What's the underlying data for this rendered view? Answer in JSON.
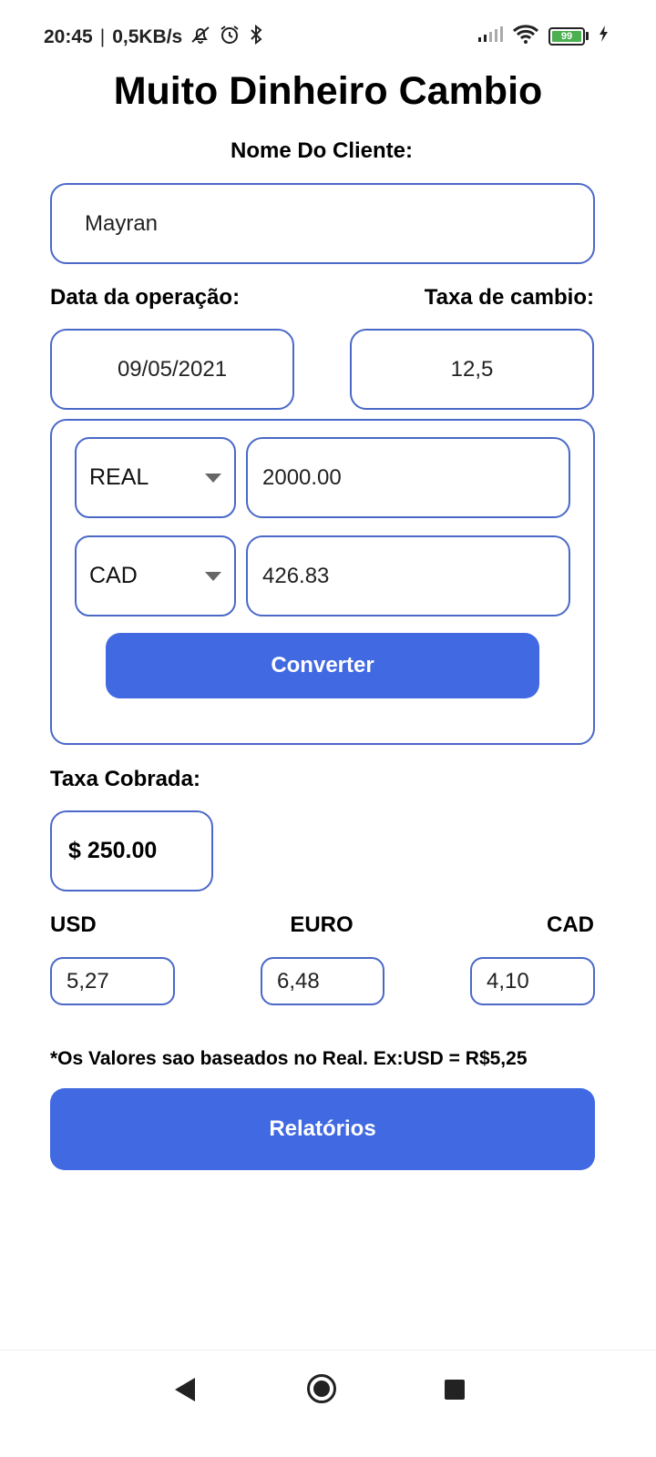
{
  "status_bar": {
    "time": "20:45",
    "separator": "|",
    "network_speed": "0,5KB/s",
    "icons_left": [
      "mute-bell-icon",
      "alarm-icon",
      "bluetooth-icon"
    ],
    "icons_right": [
      "signal-icon",
      "wifi-icon",
      "battery-icon",
      "charging-icon"
    ],
    "battery_level": "99"
  },
  "app": {
    "title": "Muito Dinheiro Cambio"
  },
  "client": {
    "label": "Nome Do Cliente:",
    "value": "Mayran"
  },
  "operation": {
    "date_label": "Data da operação:",
    "date_value": "09/05/2021",
    "rate_label": "Taxa de cambio:",
    "rate_value": "12,5"
  },
  "converter": {
    "from_currency": "REAL",
    "from_amount": "2000.00",
    "to_currency": "CAD",
    "to_amount": "426.83",
    "button_label": "Converter"
  },
  "fee": {
    "label": "Taxa Cobrada:",
    "value": "$ 250.00"
  },
  "rates": {
    "usd_label": "USD",
    "usd_value": "5,27",
    "euro_label": "EURO",
    "euro_value": "6,48",
    "cad_label": "CAD",
    "cad_value": "4,10"
  },
  "note": "*Os Valores sao baseados no Real. Ex:USD = R$5,25",
  "reports_button": "Relatórios",
  "colors": {
    "accent": "#4169e1",
    "border": "#4a68c8"
  }
}
